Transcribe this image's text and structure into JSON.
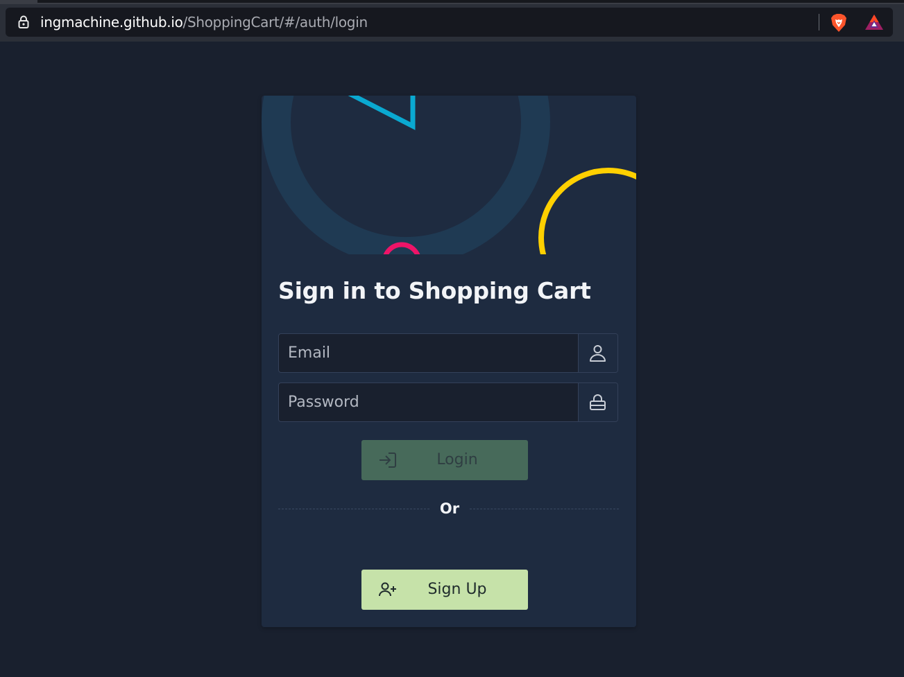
{
  "browser": {
    "url_host": "ingmachine.github.io",
    "url_path": "/ShoppingCart/#/auth/login"
  },
  "login": {
    "title": "Sign in to Shopping Cart",
    "email_placeholder": "Email",
    "password_placeholder": "Password",
    "login_label": "Login",
    "divider_text": "Or",
    "signup_label": "Sign Up"
  },
  "icons": {
    "lock": "lock-icon",
    "brave": "brave-lion-icon",
    "bat": "bat-triangle-icon",
    "user": "user-icon",
    "password_lock": "lock-icon",
    "login": "login-arrow-icon",
    "signup": "user-plus-icon"
  },
  "colors": {
    "page_bg": "#19202e",
    "card_bg": "#1e2b40",
    "login_button": "#476a5a",
    "signup_button": "#c6e2a9",
    "art_cyan": "#0aa9d1",
    "art_pink": "#ee1468",
    "art_yellow": "#ffd000",
    "art_ring": "#1f3a53"
  }
}
